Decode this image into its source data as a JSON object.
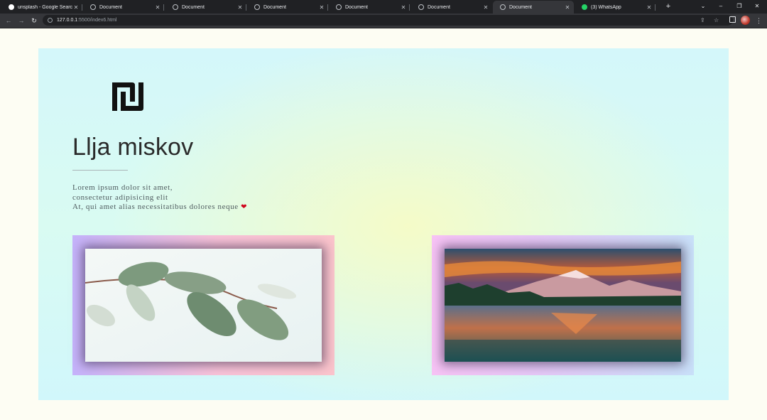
{
  "browser": {
    "tabs": [
      {
        "title": "unsplash - Google Search",
        "icon": "google-icon",
        "active": false
      },
      {
        "title": "Document",
        "icon": "globe-icon",
        "active": false
      },
      {
        "title": "Document",
        "icon": "globe-icon",
        "active": false
      },
      {
        "title": "Document",
        "icon": "globe-icon",
        "active": false
      },
      {
        "title": "Document",
        "icon": "globe-icon",
        "active": false
      },
      {
        "title": "Document",
        "icon": "globe-icon",
        "active": false
      },
      {
        "title": "Document",
        "icon": "globe-icon",
        "active": true
      },
      {
        "title": "(3) WhatsApp",
        "icon": "whatsapp-icon",
        "active": false
      }
    ],
    "address": {
      "host": "127.0.0.1",
      "path": ":5500/index6.html"
    }
  },
  "page": {
    "title": "Llja miskov",
    "description_lines": [
      "Lorem ipsum dolor sit amet,",
      "consectetur adipisicing elit",
      "At, qui amet alias necessitatibus dolores neque"
    ],
    "heart_glyph": "❤",
    "logo_icon": "shekel-logo-icon",
    "images": [
      {
        "subject": "leaves-photo"
      },
      {
        "subject": "mountain-lake-photo"
      }
    ]
  },
  "colors": {
    "card_bg": "#d4f7fa",
    "card_center_glow": "#f5fbc8",
    "heart": "#d0021b",
    "left_frame": "#c5b3fb",
    "right_frame": "#f7c3f5"
  }
}
